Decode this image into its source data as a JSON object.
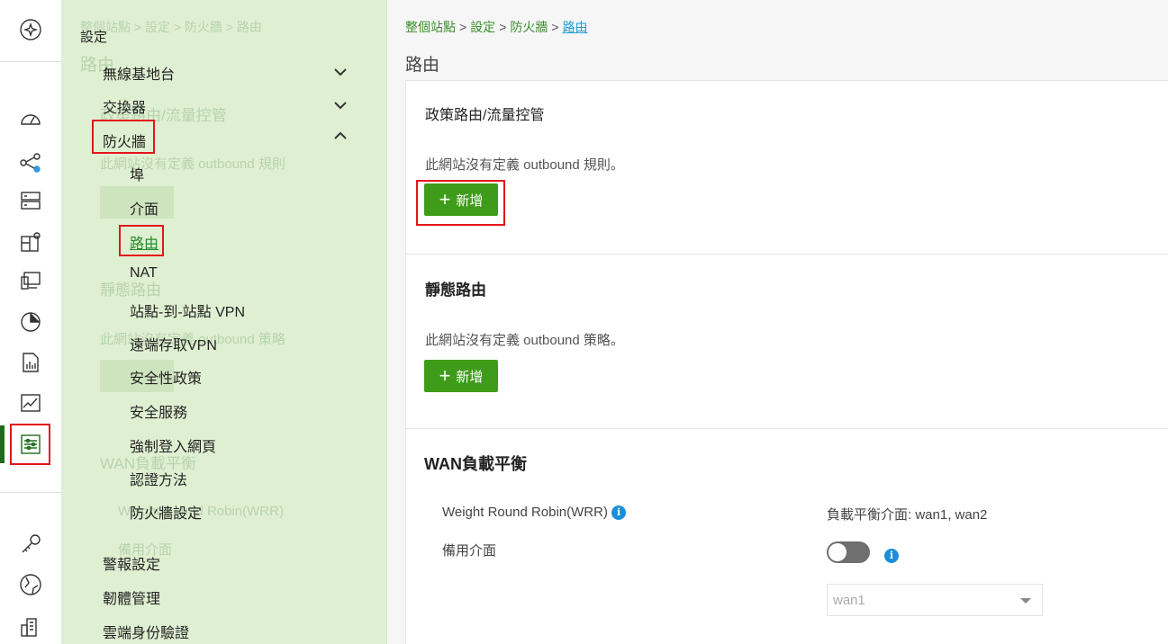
{
  "colors": {
    "accent_green": "#3f9c1a",
    "link_blue": "#1a9bd7",
    "highlight_red": "#e3161b",
    "panel_bg": "#dff0d2"
  },
  "rail": {
    "icons": [
      "sparkle-icon",
      "dashboard-gauge-icon",
      "topology-icon",
      "server-icon",
      "floorplan-icon",
      "devices-icon",
      "pie-chart-icon",
      "report-icon",
      "line-chart-icon",
      "settings-sliders-icon",
      "key-icon",
      "globe-icon",
      "building-icon"
    ]
  },
  "ghost": {
    "breadcrumb": "整個站點 > 設定 > 防火牆 > 路由",
    "title": "路由",
    "policy": "政策路由/流量控管",
    "policy_desc": "此網站沒有定義 outbound 規則",
    "static": "靜態路由",
    "static_desc": "此網站沒有定義 outbound 策略",
    "wan": "WAN負載平衡",
    "wrr": "Weight Round Robin(WRR)",
    "backup": "備用介面"
  },
  "panel": {
    "title": "設定",
    "items": [
      {
        "label": "無線基地台"
      },
      {
        "label": "交換器"
      },
      {
        "label": "防火牆"
      }
    ],
    "firewall_subitems": [
      {
        "label": "埠"
      },
      {
        "label": "介面"
      },
      {
        "label": "路由"
      },
      {
        "label": "NAT"
      },
      {
        "label": "站點-到-站點 VPN"
      },
      {
        "label": "遠端存取VPN"
      },
      {
        "label": "安全性政策"
      },
      {
        "label": "安全服務"
      },
      {
        "label": "強制登入網頁"
      },
      {
        "label": "認證方法"
      },
      {
        "label": "防火牆設定"
      }
    ],
    "bottom_items": [
      {
        "label": "警報設定"
      },
      {
        "label": "韌體管理"
      },
      {
        "label": "雲端身份驗證"
      }
    ]
  },
  "main": {
    "breadcrumb": {
      "site": "整個站點",
      "settings": "設定",
      "firewall": "防火牆",
      "current": "路由",
      "sep": ">"
    },
    "page_title": "路由",
    "policy_route": {
      "title": "政策路由/流量控管",
      "desc": "此網站沒有定義 outbound 規則。",
      "add_label": "新增",
      "plus": "+"
    },
    "static_route": {
      "title": "靜態路由",
      "desc": "此網站沒有定義 outbound 策略。",
      "add_label": "新增",
      "plus": "+"
    },
    "wan": {
      "title": "WAN負載平衡",
      "wrr_label": "Weight Round Robin(WRR)",
      "lb_interfaces": "負載平衡介面: wan1, wan2",
      "backup_label": "備用介面",
      "backup_enabled": false,
      "backup_select": "wan1",
      "info": "i"
    }
  }
}
